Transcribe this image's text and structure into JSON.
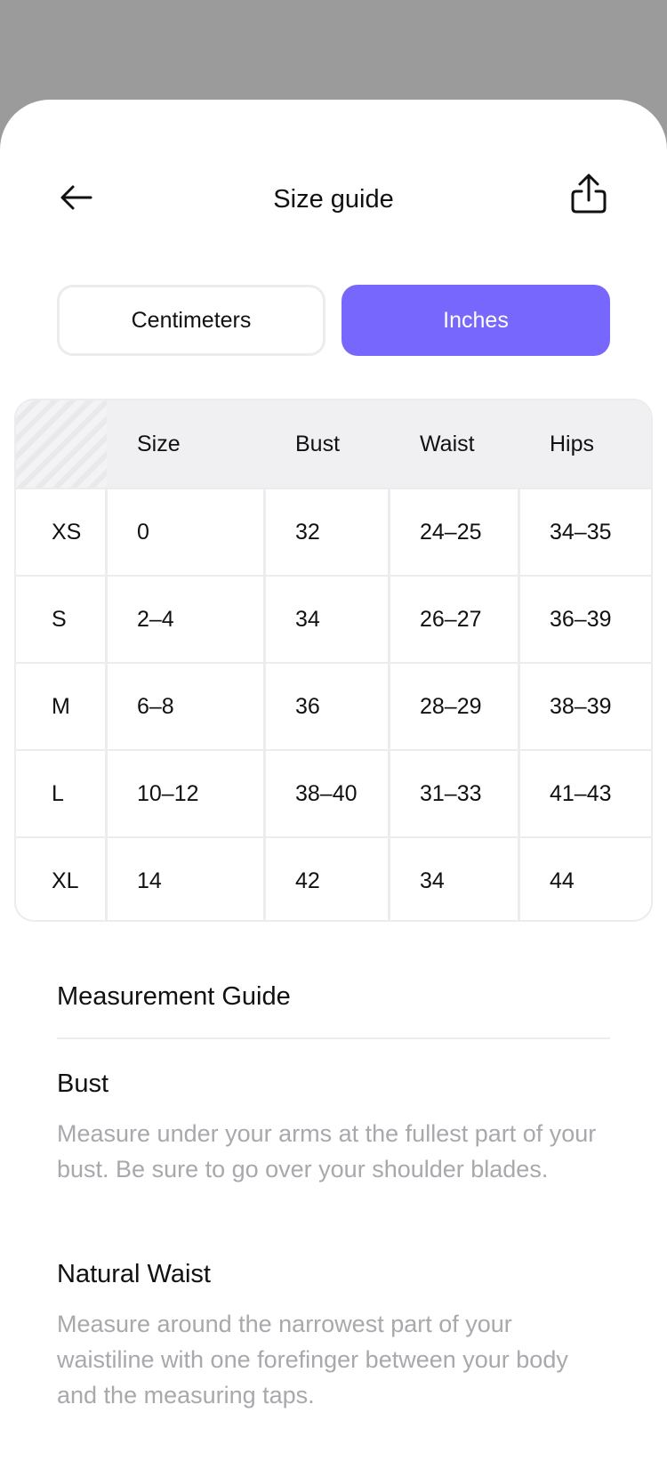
{
  "header": {
    "title": "Size guide",
    "back_icon": "arrow-left-icon",
    "share_icon": "share-icon"
  },
  "unit_toggle": {
    "options": [
      "Centimeters",
      "Inches"
    ],
    "selected": "Inches",
    "accent_color": "#7767fc"
  },
  "size_table": {
    "columns": [
      "Size",
      "Bust",
      "Waist",
      "Hips"
    ],
    "rows": [
      {
        "label": "XS",
        "size": "0",
        "bust": "32",
        "waist": "24–25",
        "hips": "34–35"
      },
      {
        "label": "S",
        "size": "2–4",
        "bust": "34",
        "waist": "26–27",
        "hips": "36–39"
      },
      {
        "label": "M",
        "size": "6–8",
        "bust": "36",
        "waist": "28–29",
        "hips": "38–39"
      },
      {
        "label": "L",
        "size": "10–12",
        "bust": "38–40",
        "waist": "31–33",
        "hips": "41–43"
      },
      {
        "label": "XL",
        "size": "14",
        "bust": "42",
        "waist": "34",
        "hips": "44"
      }
    ]
  },
  "measurement_guide": {
    "title": "Measurement Guide",
    "sections": [
      {
        "title": "Bust",
        "text": "Measure under your arms at the fullest part of your bust. Be sure to go over your shoulder blades."
      },
      {
        "title": "Natural Waist",
        "text": "Measure around the narrowest part of your waistiline with one forefinger between your body and the measuring taps."
      }
    ]
  }
}
